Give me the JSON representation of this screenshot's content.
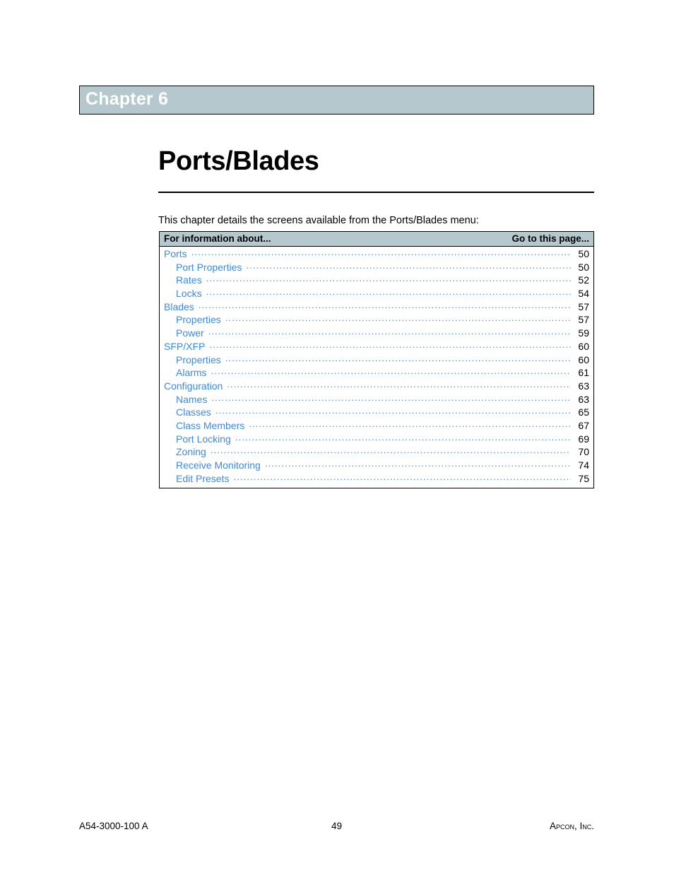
{
  "chapter": {
    "band_label": "Chapter 6",
    "title": "Ports/Blades",
    "intro": "This chapter details the screens available from the Ports/Blades menu:"
  },
  "toc": {
    "header_left": "For information about...",
    "header_right": "Go to this page...",
    "rows": [
      {
        "label": "Ports",
        "page": "50",
        "level": 1
      },
      {
        "label": "Port Properties",
        "page": "50",
        "level": 2
      },
      {
        "label": "Rates",
        "page": "52",
        "level": 2
      },
      {
        "label": "Locks",
        "page": "54",
        "level": 2
      },
      {
        "label": "Blades",
        "page": "57",
        "level": 1
      },
      {
        "label": "Properties",
        "page": "57",
        "level": 2
      },
      {
        "label": "Power",
        "page": "59",
        "level": 2
      },
      {
        "label": "SFP/XFP",
        "page": "60",
        "level": 1
      },
      {
        "label": "Properties",
        "page": "60",
        "level": 2
      },
      {
        "label": "Alarms",
        "page": "61",
        "level": 2
      },
      {
        "label": "Configuration",
        "page": "63",
        "level": 1
      },
      {
        "label": "Names",
        "page": "63",
        "level": 2
      },
      {
        "label": "Classes",
        "page": "65",
        "level": 2
      },
      {
        "label": "Class Members",
        "page": "67",
        "level": 2
      },
      {
        "label": "Port Locking",
        "page": "69",
        "level": 2
      },
      {
        "label": "Zoning",
        "page": "70",
        "level": 2
      },
      {
        "label": "Receive Monitoring",
        "page": "74",
        "level": 2
      },
      {
        "label": "Edit Presets",
        "page": "75",
        "level": 2
      }
    ]
  },
  "footer": {
    "document_number": "A54-3000-100 A",
    "page_number": "49",
    "company": "Apcon, Inc."
  },
  "colors": {
    "band_background": "#b5c8ce",
    "link": "#3b8ae8",
    "text": "#000000",
    "page_background": "#ffffff"
  }
}
